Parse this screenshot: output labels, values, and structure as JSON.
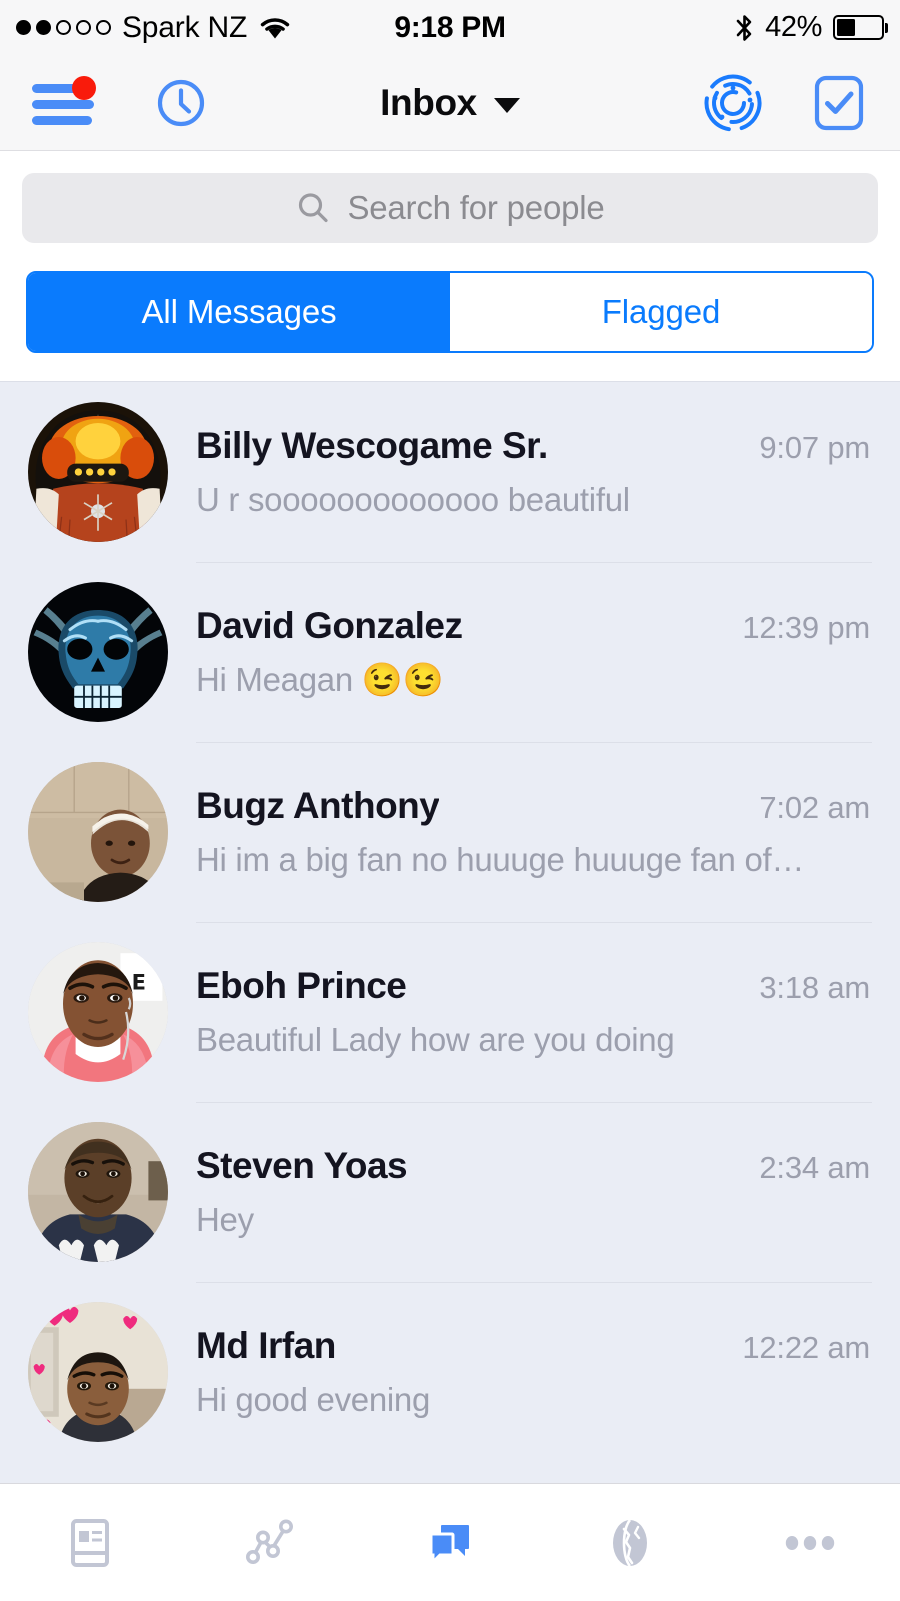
{
  "status_bar": {
    "carrier": "Spark NZ",
    "signal_bars_filled": 2,
    "signal_bars_total": 5,
    "time": "9:18 PM",
    "battery_percent": "42%",
    "battery_level": 42,
    "icons": [
      "wifi-icon",
      "bluetooth-icon",
      "battery-icon"
    ]
  },
  "nav_bar": {
    "menu_icon": "hamburger-menu-icon",
    "menu_has_badge": true,
    "badge_color": "#f91b0b",
    "clock_icon": "clock-icon",
    "title": "Inbox",
    "dropdown_icon": "chevron-down-icon",
    "radar_icon": "radar-icon",
    "check_icon": "check-square-icon",
    "accent_color": "#4a8cf7"
  },
  "search": {
    "placeholder": "Search for people",
    "icon": "search-icon",
    "value": ""
  },
  "segmented_control": {
    "active_index": 0,
    "active_color": "#0a7bfd",
    "options": [
      {
        "label": "All Messages",
        "active": true
      },
      {
        "label": "Flagged",
        "active": false
      }
    ]
  },
  "conversations": [
    {
      "name": "Billy Wescogame Sr.",
      "time": "9:07 pm",
      "preview": "U r sooooooooooooo beautiful",
      "avatar": "native-american-regalia"
    },
    {
      "name": "David Gonzalez",
      "time": "12:39 pm",
      "preview": "Hi Meagan 😉😉",
      "avatar": "blue-skull"
    },
    {
      "name": "Bugz Anthony",
      "time": "7:02 am",
      "preview": "Hi im a big fan no huuuge huuuge fan of…",
      "avatar": "man-white-durag"
    },
    {
      "name": "Eboh Prince",
      "time": "3:18 am",
      "preview": "Beautiful Lady how are you doing",
      "avatar": "man-pink-hoodie"
    },
    {
      "name": "Steven Yoas",
      "time": "2:34 am",
      "preview": "Hey",
      "avatar": "man-navy-shirt"
    },
    {
      "name": "Md Irfan",
      "time": "12:22 am",
      "preview": "Hi good evening",
      "avatar": "man-heart-wall"
    }
  ],
  "tab_bar": {
    "active_index": 2,
    "active_color": "#4a8cf7",
    "inactive_color": "#c2c6d4",
    "tabs": [
      {
        "icon": "news-feed-icon",
        "active": false
      },
      {
        "icon": "network-graph-icon",
        "active": false
      },
      {
        "icon": "messages-icon",
        "active": true
      },
      {
        "icon": "globe-icon",
        "active": false
      },
      {
        "icon": "more-dots-icon",
        "active": false
      }
    ]
  }
}
